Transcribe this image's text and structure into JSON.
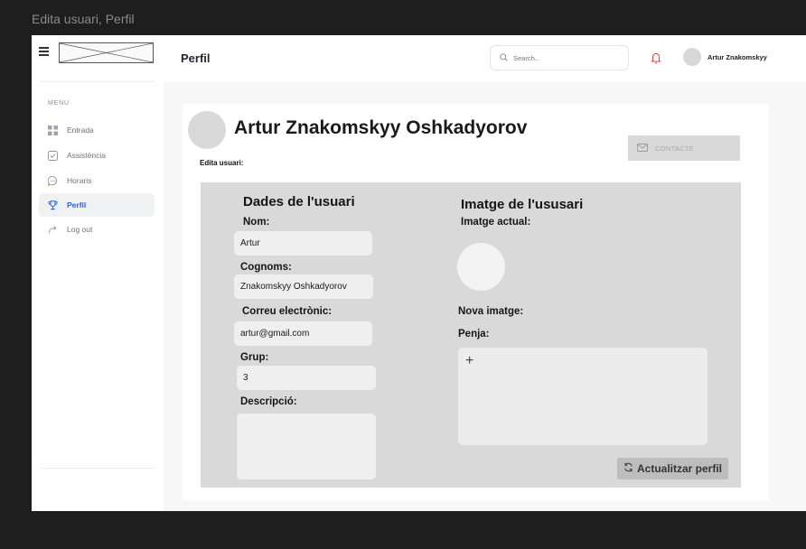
{
  "canvas": {
    "frame_title": "Edita usuari,  Perfil"
  },
  "sidebar": {
    "menu_label": "MENU",
    "items": [
      {
        "label": "Entrada",
        "icon": "grid-icon",
        "active": false
      },
      {
        "label": "Assistència",
        "icon": "check-square-icon",
        "active": false
      },
      {
        "label": "Horaris",
        "icon": "chat-bubble-icon",
        "active": false
      },
      {
        "label": "Perfil",
        "icon": "trophy-icon",
        "active": true
      },
      {
        "label": "Log out",
        "icon": "logout-arrow-icon",
        "active": false
      }
    ]
  },
  "header": {
    "title": "Perfil",
    "search_placeholder": "Search...",
    "user_name": "Artur Znakomskyy"
  },
  "profile": {
    "full_name": "Artur Znakomskyy Oshkadyorov",
    "edit_label": "Edita usuari:",
    "contact_label": "CONTACTE"
  },
  "form": {
    "user_section_title": "Dades de l'usuari",
    "name_label": "Nom:",
    "name_value": "Artur",
    "surname_label": "Cognoms:",
    "surname_value": "Znakomskyy Oshkadyorov",
    "email_label": "Correu electrònic:",
    "email_value": "artur@gmail.com",
    "group_label": "Grup:",
    "group_value": "3",
    "description_label": "Descripció:",
    "description_value": "",
    "image_section_title": "Imatge de l'ususari",
    "current_image_label": "Imatge actual:",
    "new_image_label": "Nova imatge:",
    "upload_label": "Penja:",
    "upload_plus": "+",
    "update_button": "Actualitzar perfil"
  }
}
